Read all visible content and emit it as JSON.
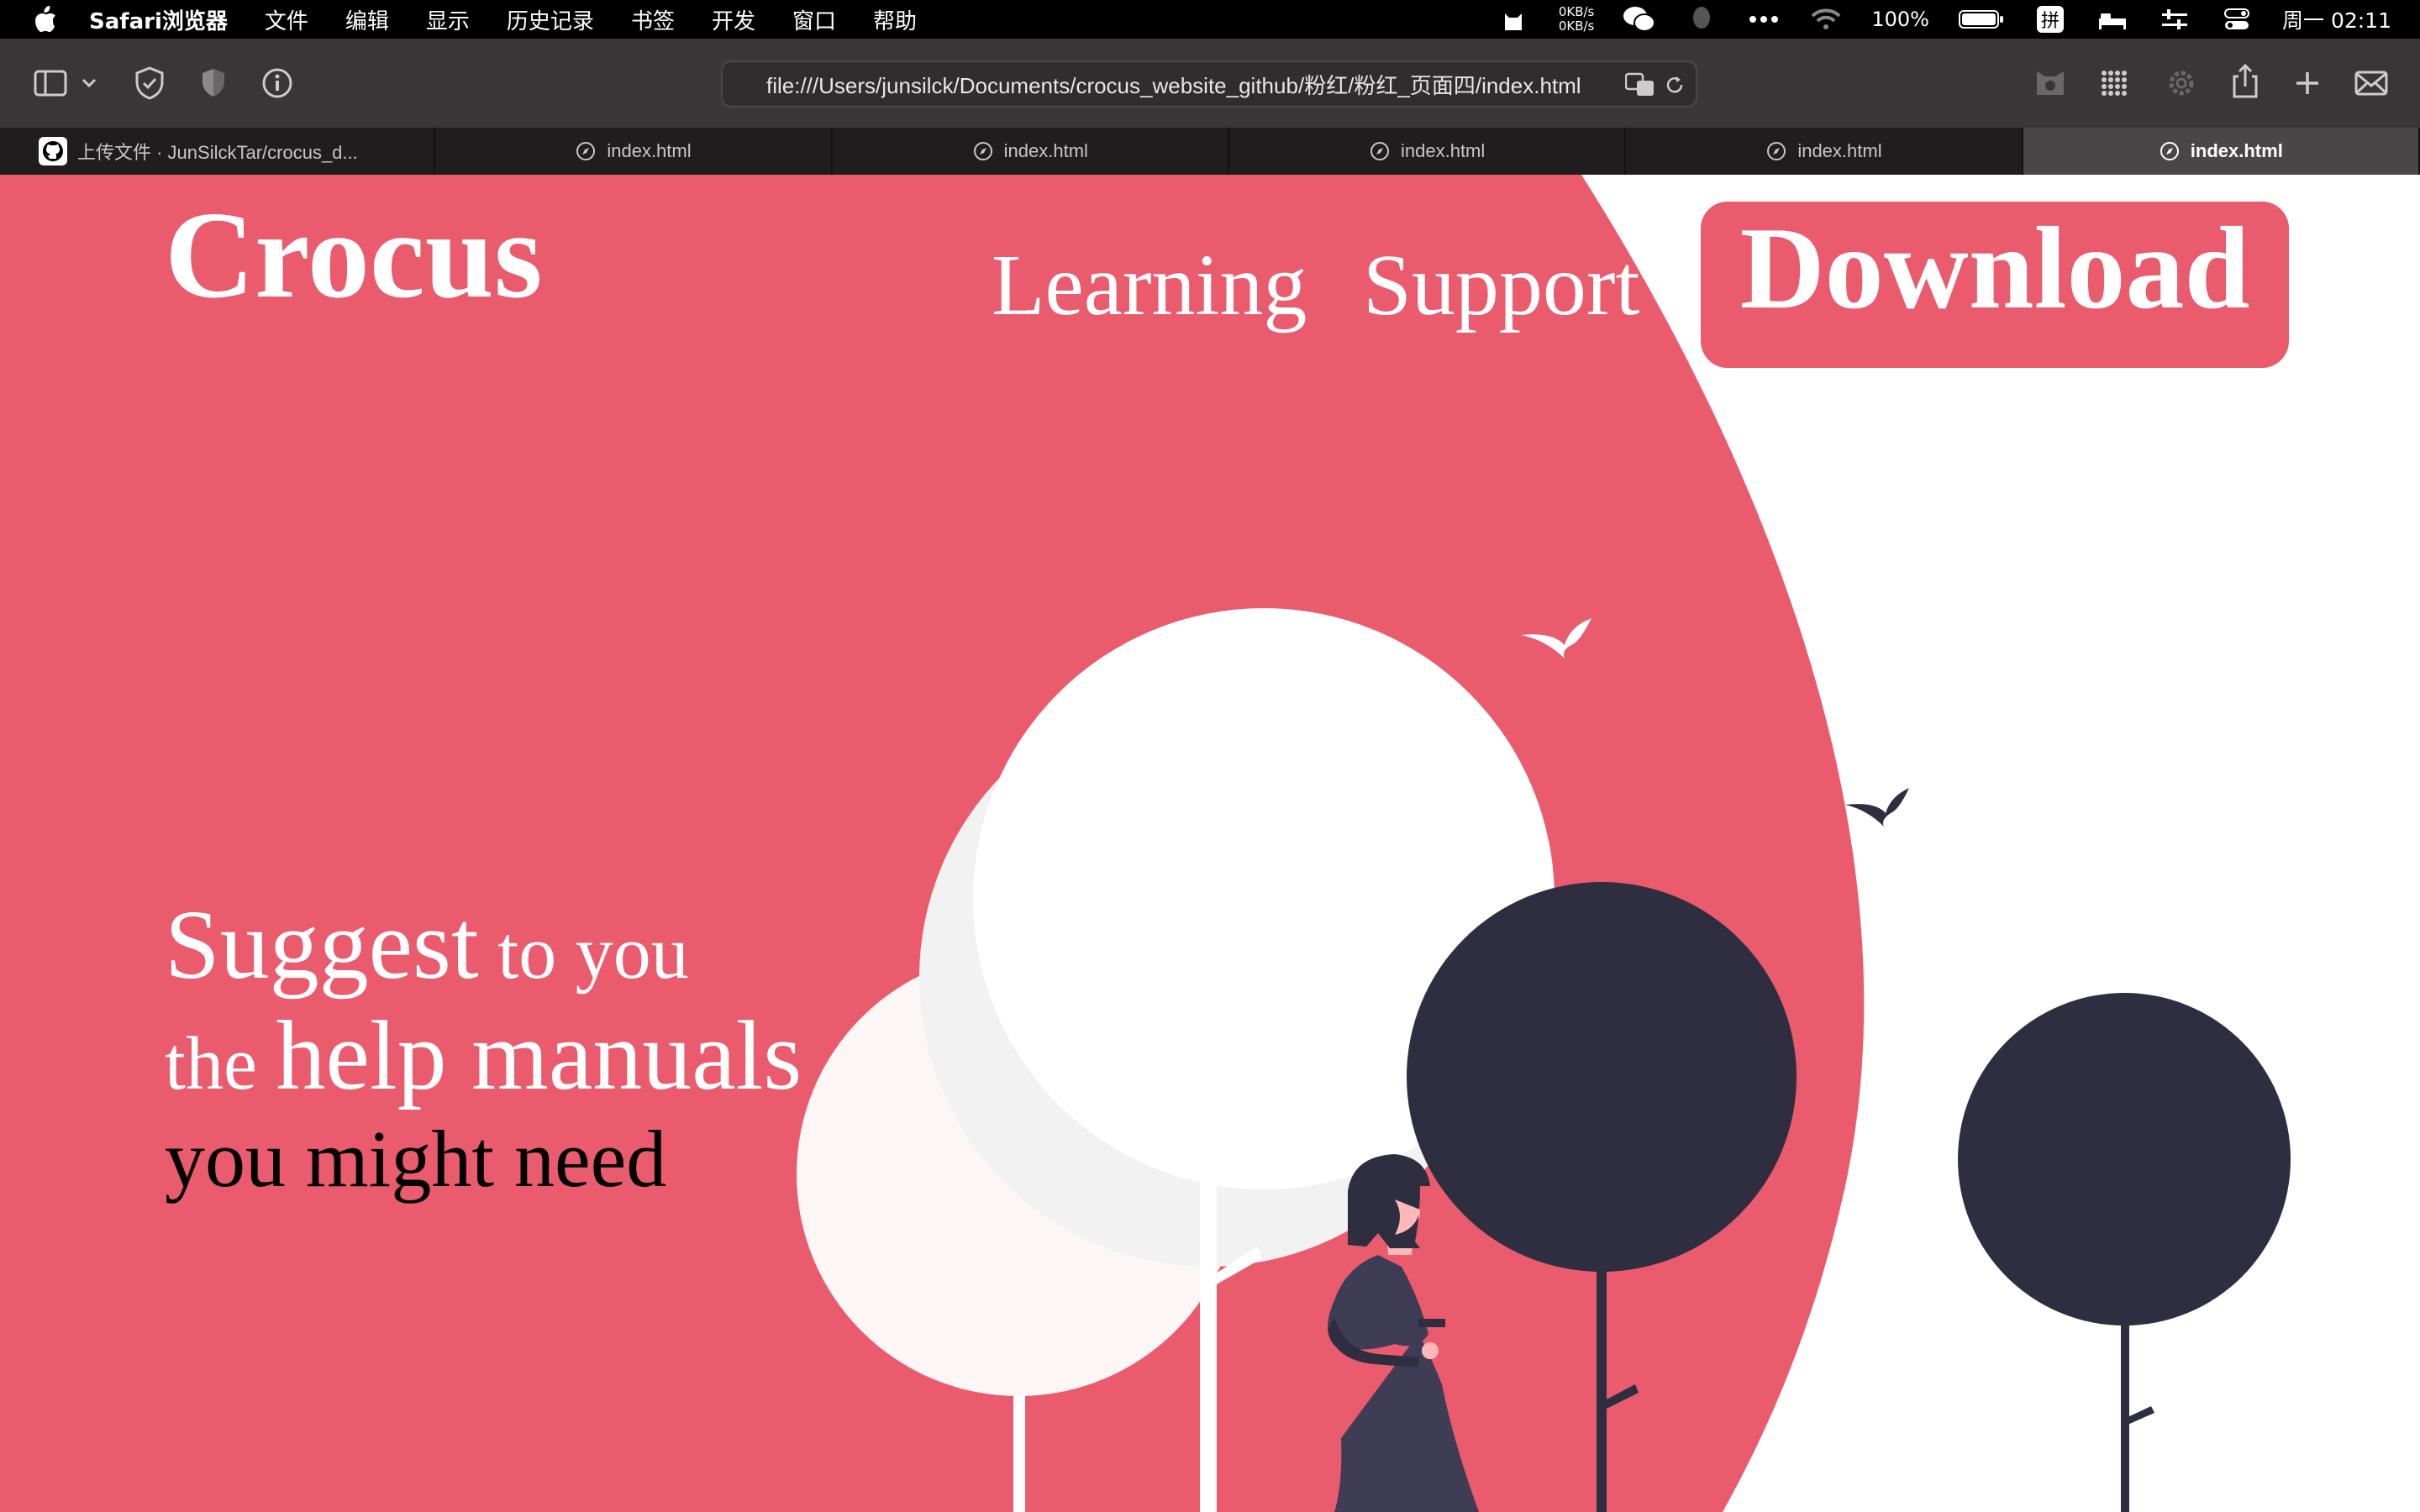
{
  "menubar": {
    "app_name": "Safari浏览器",
    "items": [
      "文件",
      "编辑",
      "显示",
      "历史记录",
      "书签",
      "开发",
      "窗口",
      "帮助"
    ],
    "net_up": "0KB/s",
    "net_down": "0KB/s",
    "battery": "100%",
    "datetime": "周一 02:11"
  },
  "toolbar": {
    "url": "file:///Users/junsilck/Documents/crocus_website_github/粉红/粉红_页面四/index.html"
  },
  "tabs": [
    {
      "label": "上传文件 · JunSilckTar/crocus_d...",
      "active": false
    },
    {
      "label": "index.html",
      "active": false
    },
    {
      "label": "index.html",
      "active": false
    },
    {
      "label": "index.html",
      "active": false
    },
    {
      "label": "index.html",
      "active": false
    },
    {
      "label": "index.html",
      "active": true
    }
  ],
  "site": {
    "logo": "Crocus",
    "nav": {
      "learning": "Learning",
      "support": "Support",
      "download": "Download"
    },
    "headline": {
      "suggest": "Suggest",
      "to_you": " to you",
      "the": "the ",
      "help_manuals": "help manuals",
      "line3": "you might need"
    }
  },
  "colors": {
    "brand_pink": "#ea5b6d",
    "dark_navy": "#2f2e41",
    "light_grey": "#f2f2f2",
    "off_white": "#fdf6f6",
    "white": "#ffffff"
  }
}
